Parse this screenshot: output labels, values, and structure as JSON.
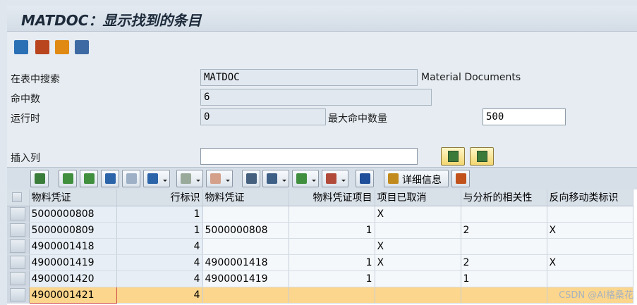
{
  "window": {
    "title": "MATDOC：显示找到的条目"
  },
  "app_toolbar": {
    "icons": [
      "refresh-icon",
      "selection-options-icon",
      "check-table-icon",
      "list-icon"
    ],
    "colors": [
      "#2b6fb5",
      "#b9451f",
      "#e08a14",
      "#3d6aa3"
    ]
  },
  "form": {
    "search_table_label": "在表中搜索",
    "search_table_value": "MATDOC",
    "search_table_desc": "Material Documents",
    "hits_label": "命中数",
    "hits_value": "6",
    "runtime_label": "运行时",
    "runtime_value": "0",
    "max_hits_label": "最大命中数量",
    "max_hits_value": "500",
    "insert_column_label": "插入列",
    "insert_column_value": ""
  },
  "grid_toolbar": {
    "details_label": "详细信息"
  },
  "table": {
    "columns": [
      "物料凭证",
      "行标识",
      "物料凭证",
      "物料凭证项目",
      "项目已取消",
      "与分析的相关性",
      "反向移动类标识"
    ],
    "rows": [
      [
        "5000000808",
        "1",
        "",
        "",
        "X",
        "",
        ""
      ],
      [
        "5000000809",
        "1",
        "5000000808",
        "1",
        "",
        "2",
        "X"
      ],
      [
        "4900001418",
        "4",
        "",
        "",
        "X",
        "",
        ""
      ],
      [
        "4900001419",
        "4",
        "4900001418",
        "1",
        "X",
        "2",
        "X"
      ],
      [
        "4900001420",
        "4",
        "4900001419",
        "1",
        "",
        "1",
        ""
      ],
      [
        "4900001421",
        "4",
        "",
        "",
        "",
        "",
        ""
      ]
    ],
    "highlighted_row": 5,
    "highlight_color": "#fcd68c"
  },
  "watermark": "CSDN @AI格桑花"
}
